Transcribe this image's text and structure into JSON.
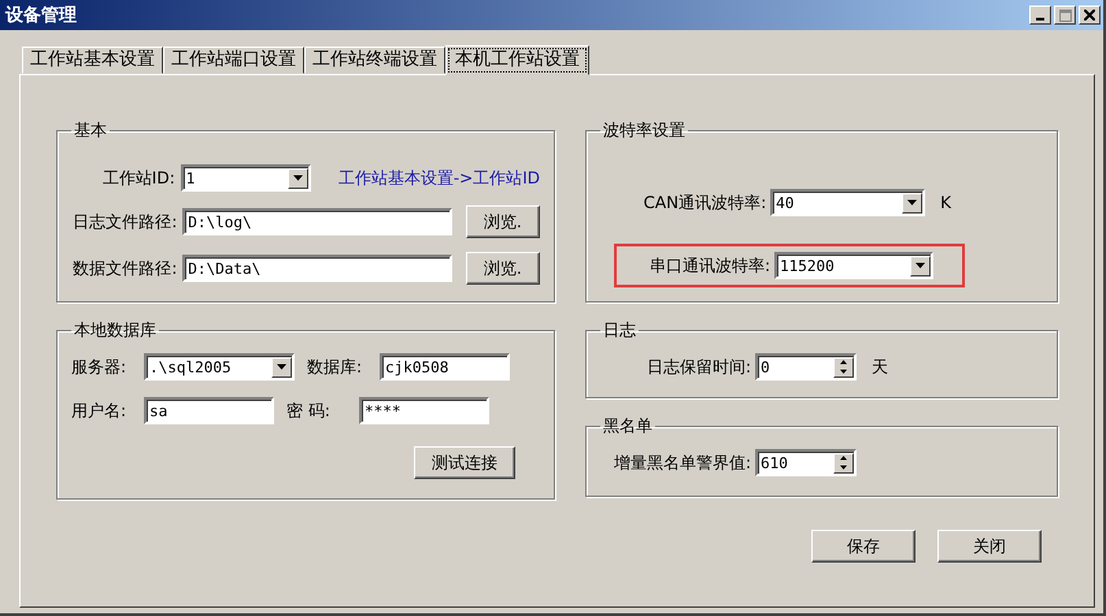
{
  "window": {
    "title": "设备管理"
  },
  "tabs": [
    {
      "label": "工作站基本设置",
      "selected": false
    },
    {
      "label": "工作站端口设置",
      "selected": false
    },
    {
      "label": "工作站终端设置",
      "selected": false
    },
    {
      "label": "本机工作站设置",
      "selected": true
    }
  ],
  "left": [
    {
      "title": "基本",
      "rows": [
        {
          "fields": [
            {
              "label": "工作站ID:",
              "kind": "combo",
              "value": "1",
              "note": "工作站基本设置->工作站ID"
            }
          ]
        },
        {
          "fields": [
            {
              "label": "日志文件路径:",
              "kind": "text",
              "value": "D:\\log\\",
              "button": "浏览."
            }
          ]
        },
        {
          "fields": [
            {
              "label": "数据文件路径:",
              "kind": "text",
              "value": "D:\\Data\\",
              "button": "浏览."
            }
          ]
        }
      ]
    },
    {
      "title": "本地数据库",
      "rows": [
        {
          "fields": [
            {
              "label": "服务器:",
              "kind": "combo",
              "value": ".\\sql2005"
            },
            {
              "label": "数据库:",
              "kind": "text",
              "value": "cjk0508"
            }
          ]
        },
        {
          "fields": [
            {
              "label": "用户名:",
              "kind": "text",
              "value": "sa"
            },
            {
              "label": "密  码:",
              "kind": "text",
              "value": "****"
            }
          ]
        }
      ],
      "button": "测试连接"
    }
  ],
  "right": [
    {
      "title": "波特率设置",
      "rows": [
        {
          "highlighted": false,
          "fields": [
            {
              "label": "CAN通讯波特率:",
              "kind": "combo",
              "value": "40",
              "unit": "K"
            }
          ]
        },
        {
          "highlighted": true,
          "fields": [
            {
              "label": "串口通讯波特率:",
              "kind": "combo",
              "value": "115200"
            }
          ]
        }
      ]
    },
    {
      "title": "日志",
      "rows": [
        {
          "fields": [
            {
              "label": "日志保留时间:",
              "kind": "spin",
              "value": "0",
              "unit": "天"
            }
          ]
        }
      ]
    },
    {
      "title": "黑名单",
      "rows": [
        {
          "fields": [
            {
              "label": "增量黑名单警界值:",
              "kind": "spin",
              "value": "610"
            }
          ]
        }
      ]
    }
  ],
  "buttons": [
    "保存",
    "关闭"
  ]
}
